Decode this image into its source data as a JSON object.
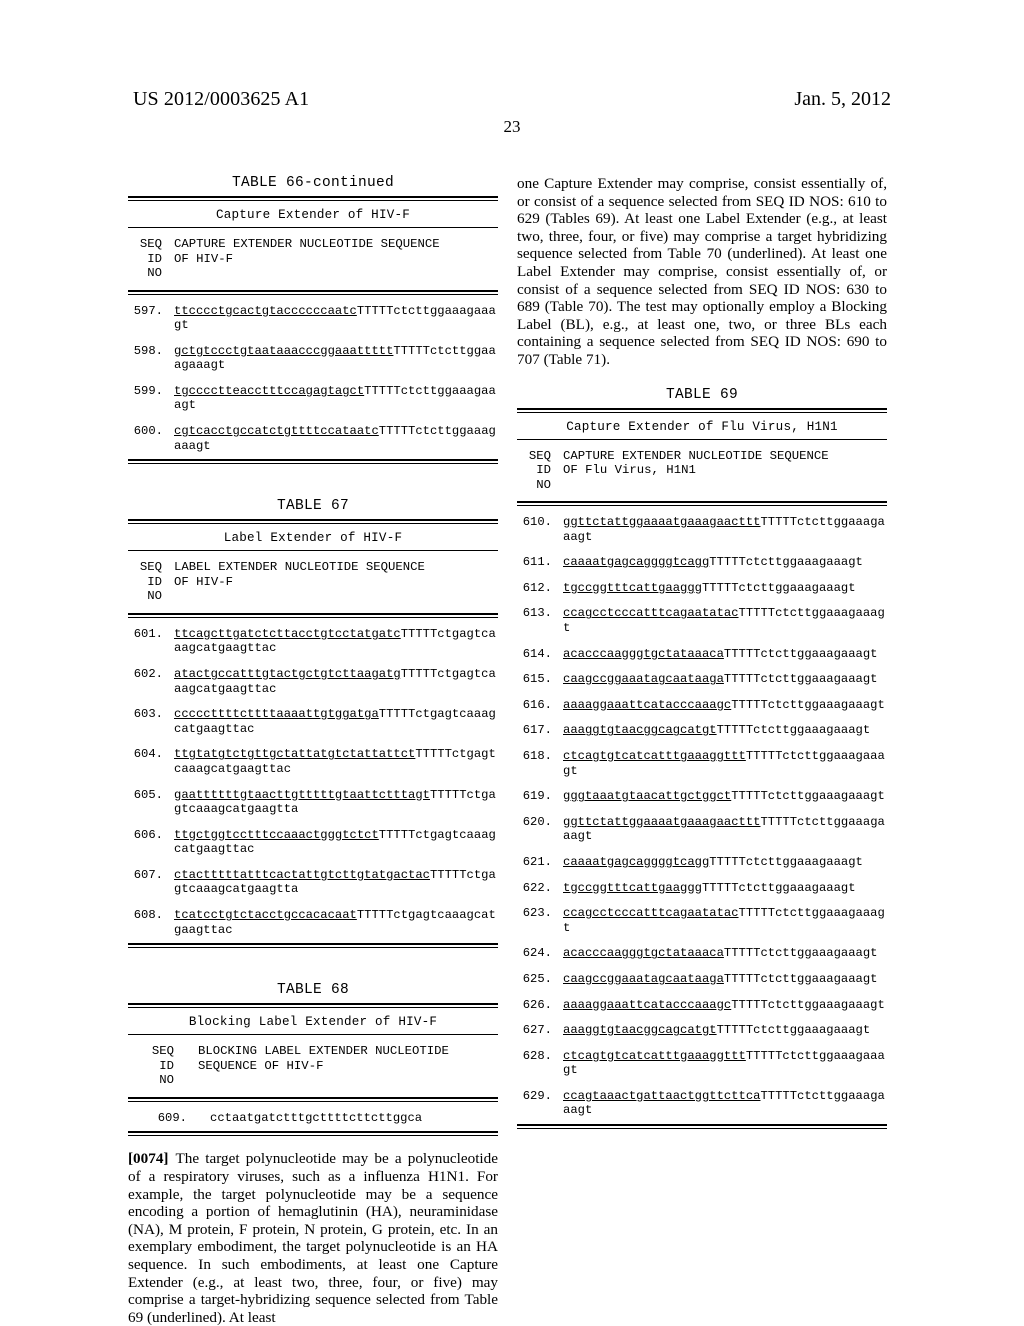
{
  "header": {
    "publication_number": "US 2012/0003625 A1",
    "date": "Jan. 5, 2012",
    "page_number": "23"
  },
  "tables": {
    "t66": {
      "title": "TABLE 66-continued",
      "subtitle": "Capture Extender of HIV-F",
      "col_head_id": "SEQ\n ID\n NO",
      "col_head_desc": "CAPTURE EXTENDER NUCLEOTIDE SEQUENCE\nOF HIV-F",
      "rows": [
        {
          "id": "597.",
          "underlined": "ttcccctgcactgtaccccccaatc",
          "plain": "TTTTTctcttggaaagaaagt"
        },
        {
          "id": "598.",
          "underlined": "gctgtccctgtaataaacccggaaattttt",
          "plain": "TTTTTctcttggaaagaaagt"
        },
        {
          "id": "599.",
          "underlined": "tgcccctteacctttccagagtagct",
          "plain": "TTTTTctcttggaaagaaagt"
        },
        {
          "id": "600.",
          "underlined": "cgtcacctgccatctgttttccataatc",
          "plain": "TTTTTctcttggaaagaaagt"
        }
      ]
    },
    "t67": {
      "title": "TABLE 67",
      "subtitle": "Label Extender of HIV-F",
      "col_head_id": "SEQ\n ID\n NO",
      "col_head_desc": "LABEL EXTENDER NUCLEOTIDE SEQUENCE\nOF HIV-F",
      "rows": [
        {
          "id": "601.",
          "underlined": "ttcagcttgatctcttacctgtcctatgatc",
          "plain": "TTTTTctgagtcaaagcatgaagttac"
        },
        {
          "id": "602.",
          "underlined": "atactgccatttgtactgctgtcttaagatg",
          "plain": "TTTTTctgagtcaaagcatgaagttac"
        },
        {
          "id": "603.",
          "underlined": "cccccttttcttttaaaattgtggatga",
          "plain": "TTTTTctgagtcaaagcatgaagttac"
        },
        {
          "id": "604.",
          "underlined": "ttgtatgtctgttgctattatgtctattattct",
          "plain": "TTTTTctgagtcaaagcatgaagttac"
        },
        {
          "id": "605.",
          "underlined": "gaattttttgtaacttgtttttgtaattctttagt",
          "plain": "TTTTTctgagtcaaagcatgaagtta"
        },
        {
          "id": "606.",
          "underlined": "ttgctggtcctttccaaactgggtctct",
          "plain": "TTTTTctgagtcaaagcatgaagttac"
        },
        {
          "id": "607.",
          "underlined": "ctactttttatttcactattgtcttgtatgactac",
          "plain": "TTTTTctgagtcaaagcatgaagtta"
        },
        {
          "id": "608.",
          "underlined": "tcatcctgtctacctgccacacaat",
          "plain": "TTTTTctgagtcaaagcatgaagttac"
        }
      ]
    },
    "t68": {
      "title": "TABLE 68",
      "subtitle": "Blocking Label Extender of HIV-F",
      "col_head_id": "SEQ\n ID\n NO",
      "col_head_desc": "BLOCKING LABEL EXTENDER NUCLEOTIDE\nSEQUENCE OF HIV-F",
      "rows": [
        {
          "id": "609.",
          "underlined": "",
          "plain": "cctaatgatctttgcttttcttcttggca"
        }
      ]
    },
    "t69": {
      "title": "TABLE 69",
      "subtitle": "Capture Extender of Flu Virus, H1N1",
      "col_head_id": "SEQ\n ID\n NO",
      "col_head_desc": "CAPTURE EXTENDER NUCLEOTIDE SEQUENCE\nOF Flu Virus, H1N1",
      "rows": [
        {
          "id": "610.",
          "underlined": "ggttctattggaaaatgaaagaacttt",
          "plain": "TTTTTctcttggaaagaaagt"
        },
        {
          "id": "611.",
          "underlined": "caaaatgagcaggggtcagg",
          "plain": "TTTTTctcttggaaagaaagt"
        },
        {
          "id": "612.",
          "underlined": "tgccggtttcattgaaggg",
          "plain": "TTTTTctcttggaaagaaagt"
        },
        {
          "id": "613.",
          "underlined": "ccagcctcccatttcagaatatac",
          "plain": "TTTTTctcttggaaagaaagt"
        },
        {
          "id": "614.",
          "underlined": "acacccaagggtgctataaaca",
          "plain": "TTTTTctcttggaaagaaagt"
        },
        {
          "id": "615.",
          "underlined": "caagccggaaatagcaataaga",
          "plain": "TTTTTctcttggaaagaaagt"
        },
        {
          "id": "616.",
          "underlined": "aaaaggaaattcatacccaaagc",
          "plain": "TTTTTctcttggaaagaaagt"
        },
        {
          "id": "617.",
          "underlined": "aaaggtgtaacggcagcatgt",
          "plain": "TTTTTctcttggaaagaaagt"
        },
        {
          "id": "618.",
          "underlined": "ctcagtgtcatcatttgaaaggttt",
          "plain": "TTTTTctcttggaaagaaagt"
        },
        {
          "id": "619.",
          "underlined": "gggtaaatgtaacattgctggct",
          "plain": "TTTTTctcttggaaagaaagt"
        },
        {
          "id": "620.",
          "underlined": "ggttctattggaaaatgaaagaacttt",
          "plain": "TTTTTctcttggaaagaaagt"
        },
        {
          "id": "621.",
          "underlined": "caaaatgagcaggggtcagg",
          "plain": "TTTTTctcttggaaagaaagt"
        },
        {
          "id": "622.",
          "underlined": "tgccggtttcattgaaggg",
          "plain": "TTTTTctcttggaaagaaagt"
        },
        {
          "id": "623.",
          "underlined": "ccagcctcccatttcagaatatac",
          "plain": "TTTTTctcttggaaagaaagt"
        },
        {
          "id": "624.",
          "underlined": "acacccaagggtgctataaaca",
          "plain": "TTTTTctcttggaaagaaagt"
        },
        {
          "id": "625.",
          "underlined": "caagccggaaatagcaataaga",
          "plain": "TTTTTctcttggaaagaaagt"
        },
        {
          "id": "626.",
          "underlined": "aaaaggaaattcatacccaaagc",
          "plain": "TTTTTctcttggaaagaaagt"
        },
        {
          "id": "627.",
          "underlined": "aaaggtgtaacggcagcatgt",
          "plain": "TTTTTctcttggaaagaaagt"
        },
        {
          "id": "628.",
          "underlined": "ctcagtgtcatcatttgaaaggttt",
          "plain": "TTTTTctcttggaaagaaagt"
        },
        {
          "id": "629.",
          "underlined": "ccagtaaactgattaactggttcttca",
          "plain": "TTTTTctcttggaaagaaagt"
        }
      ]
    }
  },
  "paragraphs": {
    "p0074_number": "[0074]",
    "p0074_text": "The target polynucleotide may be a polynucleotide of a respiratory viruses, such as a influenza H1N1. For example, the target polynucleotide may be a sequence encoding a portion of hemaglutinin (HA), neuraminidase (NA), M protein, F protein, N protein, G protein, etc. In an exemplary embodiment, the target polynucleotide is an HA sequence. In such embodiments, at least one Capture Extender (e.g., at least two, three, four, or five) may comprise a target-hybridizing sequence selected from Table 69 (underlined). At least",
    "right_top_text": "one Capture Extender may comprise, consist essentially of, or consist of a sequence selected from SEQ ID NOS: 610 to 629 (Tables 69). At least one Label Extender (e.g., at least two, three, four, or five) may comprise a target hybridizing sequence selected from Table 70 (underlined). At least one Label Extender may comprise, consist essentially of, or consist of a sequence selected from SEQ ID NOS: 630 to 689 (Table 70). The test may optionally employ a Blocking Label (BL), e.g., at least one, two, or three BLs each containing a sequence selected from SEQ ID NOS: 690 to 707 (Table 71)."
  }
}
